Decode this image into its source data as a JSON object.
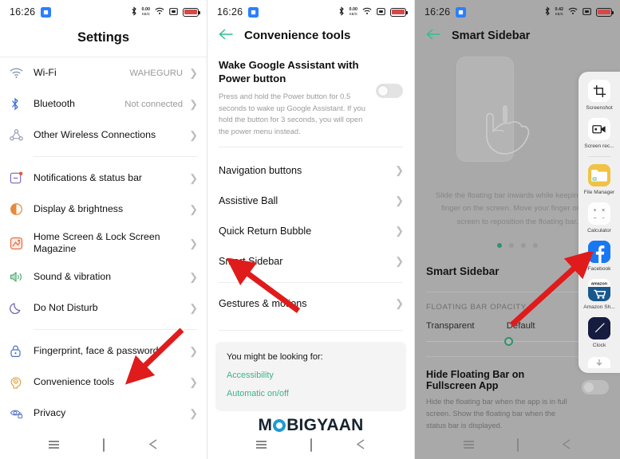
{
  "status_bar": {
    "time": "16:26",
    "badge_icon": "sim-badge-icon",
    "data_speed_value": "0.00",
    "data_speed_unit": "KB/S",
    "data_speed_value_3": "0.42",
    "icons": [
      "bluetooth-icon",
      "data-speed-icon",
      "wifi-icon",
      "screencast-icon",
      "battery-icon"
    ]
  },
  "panel1": {
    "title": "Settings",
    "items": [
      {
        "label": "Wi-Fi",
        "value": "WAHEGURU",
        "icon": "wifi-icon",
        "color": "#7e8fa6"
      },
      {
        "label": "Bluetooth",
        "value": "Not connected",
        "icon": "bluetooth-icon",
        "color": "#3d6fd6"
      },
      {
        "label": "Other Wireless Connections",
        "value": "",
        "icon": "wireless-icon",
        "color": "#8a96b4"
      },
      {
        "label": "Notifications & status bar",
        "value": "",
        "icon": "notifications-icon",
        "color": "#7b63b8"
      },
      {
        "label": "Display & brightness",
        "value": "",
        "icon": "brightness-icon",
        "color": "#e8893c"
      },
      {
        "label": "Home Screen & Lock Screen Magazine",
        "value": "",
        "icon": "home-screen-icon",
        "color": "#e0683e"
      },
      {
        "label": "Sound & vibration",
        "value": "",
        "icon": "sound-icon",
        "color": "#4aa96c"
      },
      {
        "label": "Do Not Disturb",
        "value": "",
        "icon": "moon-icon",
        "color": "#6f5fb0"
      },
      {
        "label": "Fingerprint, face & password",
        "value": "",
        "icon": "lock-icon",
        "color": "#4a6fc4"
      },
      {
        "label": "Convenience tools",
        "value": "",
        "icon": "head-gear-icon",
        "color": "#dda13a"
      },
      {
        "label": "Privacy",
        "value": "",
        "icon": "privacy-eye-icon",
        "color": "#5b79c8"
      }
    ]
  },
  "panel2": {
    "title": "Convenience tools",
    "back_icon": "back-arrow-icon",
    "wake_setting": {
      "title": "Wake Google Assistant with Power button",
      "description": "Press and hold the Power button for 0.5 seconds to wake up Google Assistant. If you hold the button for 3 seconds, you will open the power menu instead.",
      "toggle_state": "off"
    },
    "rows": [
      {
        "label": "Navigation buttons"
      },
      {
        "label": "Assistive Ball"
      },
      {
        "label": "Quick Return Bubble"
      },
      {
        "label": "Smart Sidebar"
      }
    ],
    "rows_after_sep": [
      {
        "label": "Gestures & motions"
      }
    ],
    "suggestions": {
      "title": "You might be looking for:",
      "links": [
        "Accessibility",
        "Automatic on/off"
      ],
      "link_color": "#3bb48a"
    },
    "watermark": {
      "before": "M",
      "ring": "O",
      "after": "BIGYAAN"
    }
  },
  "panel3": {
    "title": "Smart Sidebar",
    "back_icon": "back-arrow-icon",
    "instruction": "Slide the floating bar inwards while keeping your finger on the screen. Move your finger on the screen to reposition the floating bar.",
    "page_dots": {
      "count": 4,
      "active_index": 0,
      "active_color": "#2f9469"
    },
    "section_title": "Smart Sidebar",
    "opacity_label": "FLOATING BAR OPACITY",
    "slider": {
      "left_label": "Transparent",
      "right_label": "Default",
      "position_percent": 43
    },
    "hide_setting": {
      "title": "Hide Floating Bar on Fullscreen App",
      "description": "Hide the floating bar when the app is in full screen. Show the floating bar when the status bar is displayed.",
      "toggle_state": "off"
    },
    "floating_bar": {
      "items": [
        {
          "label": "Screenshot",
          "icon": "crop-screenshot-icon"
        },
        {
          "label": "Screen rec...",
          "icon": "screen-record-icon"
        },
        {
          "label": "File Manager",
          "icon": "file-manager-icon"
        },
        {
          "label": "Calculator",
          "icon": "calculator-icon"
        },
        {
          "label": "Facebook",
          "icon": "facebook-icon"
        },
        {
          "label": "Amazon Sh...",
          "icon": "amazon-shopping-icon"
        },
        {
          "label": "Clock",
          "icon": "clock-icon"
        }
      ]
    }
  },
  "nav_bar": {
    "items": [
      "menu-icon",
      "home-square-icon",
      "back-triangle-icon"
    ]
  },
  "annotations": [
    {
      "name": "arrow-to-convenience-tools",
      "color": "#e01b1b"
    },
    {
      "name": "arrow-to-smart-sidebar",
      "color": "#e01b1b"
    },
    {
      "name": "arrow-to-floating-bar",
      "color": "#e01b1b"
    }
  ]
}
